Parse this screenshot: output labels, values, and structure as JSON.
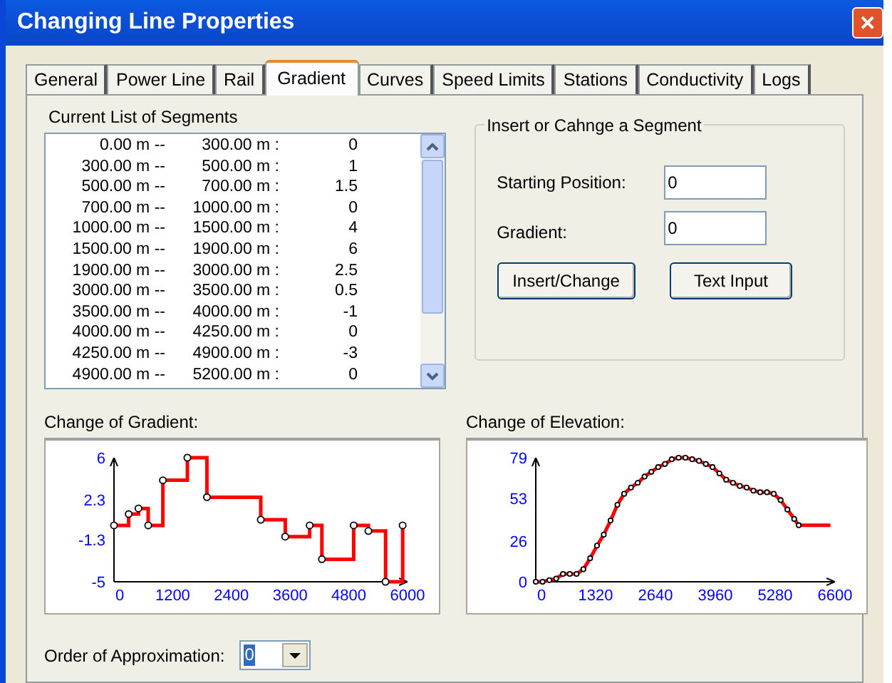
{
  "window": {
    "title": "Changing Line Properties",
    "close": "✕"
  },
  "tabs": [
    {
      "label": "General",
      "selected": false
    },
    {
      "label": "Power Line",
      "selected": false
    },
    {
      "label": "Rail",
      "selected": false
    },
    {
      "label": "Gradient",
      "selected": true
    },
    {
      "label": "Curves",
      "selected": false
    },
    {
      "label": "Speed Limits",
      "selected": false
    },
    {
      "label": "Stations",
      "selected": false
    },
    {
      "label": "Conductivity",
      "selected": false
    },
    {
      "label": "Logs",
      "selected": false
    }
  ],
  "segments": {
    "label": "Current List of Segments",
    "rows": [
      {
        "from": "0.00 m --",
        "to": "300.00 m :",
        "gradient": "0"
      },
      {
        "from": "300.00 m --",
        "to": "500.00 m :",
        "gradient": "1"
      },
      {
        "from": "500.00 m --",
        "to": "700.00 m :",
        "gradient": "1.5"
      },
      {
        "from": "700.00 m --",
        "to": "1000.00 m :",
        "gradient": "0"
      },
      {
        "from": "1000.00 m --",
        "to": "1500.00 m :",
        "gradient": "4"
      },
      {
        "from": "1500.00 m --",
        "to": "1900.00 m :",
        "gradient": "6"
      },
      {
        "from": "1900.00 m --",
        "to": "3000.00 m :",
        "gradient": "2.5"
      },
      {
        "from": "3000.00 m --",
        "to": "3500.00 m :",
        "gradient": "0.5"
      },
      {
        "from": "3500.00 m --",
        "to": "4000.00 m :",
        "gradient": "-1"
      },
      {
        "from": "4000.00 m --",
        "to": "4250.00 m :",
        "gradient": "0"
      },
      {
        "from": "4250.00 m --",
        "to": "4900.00 m :",
        "gradient": "-3"
      },
      {
        "from": "4900.00 m --",
        "to": "5200.00 m :",
        "gradient": "0"
      }
    ]
  },
  "insert_group": {
    "title": "Insert or Cahnge a Segment",
    "starting_position": {
      "label": "Starting Position:",
      "value": "0"
    },
    "gradient": {
      "label": "Gradient:",
      "value": "0"
    },
    "buttons": [
      "Insert/Change",
      "Text Input"
    ]
  },
  "gradient_chart": {
    "label": "Change of Gradient:",
    "chart_data": {
      "type": "line",
      "x": [
        0,
        300,
        300,
        500,
        500,
        700,
        700,
        1000,
        1000,
        1500,
        1500,
        1900,
        1900,
        3000,
        3000,
        3500,
        3500,
        4000,
        4000,
        4250,
        4250,
        4900,
        4900,
        5200,
        5200,
        5550,
        5550,
        5900,
        5900,
        5950
      ],
      "series": [
        {
          "color": "#ff0000",
          "marker": "circle",
          "values": [
            0,
            0,
            1,
            1,
            1.5,
            1.5,
            0,
            0,
            4,
            4,
            6,
            6,
            2.5,
            2.5,
            0.5,
            0.5,
            -1,
            -1,
            0,
            0,
            -3,
            -3,
            0,
            0,
            -0.5,
            -0.5,
            -5,
            -5,
            0,
            0
          ]
        }
      ],
      "xlim": [
        0,
        6000
      ],
      "ylim": [
        -5,
        6
      ],
      "xticks": [
        0,
        1200,
        2400,
        3600,
        4800,
        6000
      ],
      "yticks": [
        -5,
        -1.3,
        2.3,
        6
      ]
    }
  },
  "elevation_chart": {
    "label": "Change of Elevation:",
    "chart_data": {
      "type": "line",
      "x": [
        0,
        150,
        300,
        450,
        600,
        750,
        900,
        1050,
        1200,
        1350,
        1500,
        1650,
        1800,
        1950,
        2100,
        2250,
        2400,
        2550,
        2700,
        2850,
        3000,
        3150,
        3300,
        3450,
        3600,
        3750,
        3900,
        4050,
        4200,
        4350,
        4500,
        4650,
        4800,
        4950,
        5100,
        5250,
        5400,
        5550,
        5700,
        5800,
        6500
      ],
      "series": [
        {
          "color": "#ff0000",
          "marker": "circle",
          "values": [
            0,
            0,
            1,
            2,
            5,
            5,
            5,
            8,
            15,
            23,
            30,
            39,
            49,
            56,
            60,
            63,
            67,
            70,
            73,
            75,
            78,
            79,
            79,
            78,
            77,
            75,
            73,
            69,
            65,
            63,
            61,
            60,
            58,
            57,
            57,
            56,
            52,
            46,
            40,
            36,
            36
          ]
        }
      ],
      "xlim": [
        0,
        6600
      ],
      "ylim": [
        0,
        79
      ],
      "xticks": [
        0,
        1320,
        2640,
        3960,
        5280,
        6600
      ],
      "yticks": [
        0,
        26,
        53,
        79
      ]
    }
  },
  "approximation": {
    "label": "Order of Approximation:",
    "value": "0"
  }
}
